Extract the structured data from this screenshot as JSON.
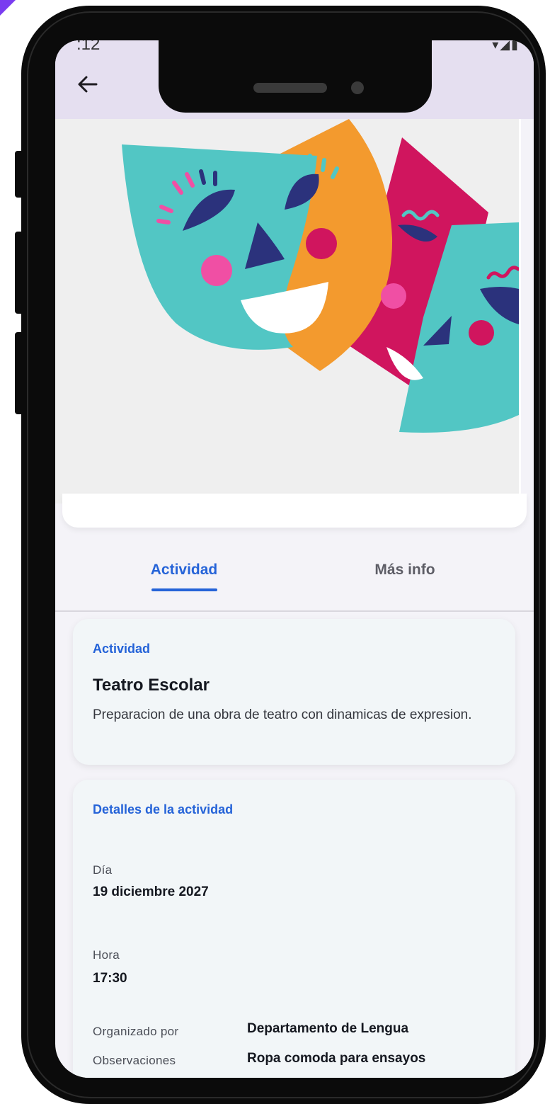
{
  "status_bar": {
    "time": ":12",
    "icons": "▾◢▮"
  },
  "appbar": {
    "title": "Teatro Escolar",
    "back_icon": "arrow-left-icon"
  },
  "hero": {
    "image": "theater-masks-illustration"
  },
  "tabs": [
    {
      "label": "Actividad",
      "active": true
    },
    {
      "label": "Más info",
      "active": false
    }
  ],
  "activity_card": {
    "section": "Actividad",
    "title": "Teatro Escolar",
    "description": "Preparacion de una obra de teatro con dinamicas de expresion."
  },
  "details_card": {
    "section": "Detalles de la actividad",
    "day_label": "Día",
    "day_value": "19 diciembre 2027",
    "time_label": "Hora",
    "time_value": "17:30",
    "organizer_label": "Organizado por",
    "organizer_value": "Departamento de Lengua",
    "notes_label": "Observaciones",
    "notes_value": "Ropa comoda para ensayos"
  },
  "colors": {
    "accent": "#2563d8",
    "appbar": "#e5dff0",
    "mask_teal": "#52c6c4",
    "mask_orange": "#f39a2e",
    "mask_magenta": "#d0155e",
    "mask_navy": "#2b327c",
    "mask_pink": "#f04fa4"
  }
}
